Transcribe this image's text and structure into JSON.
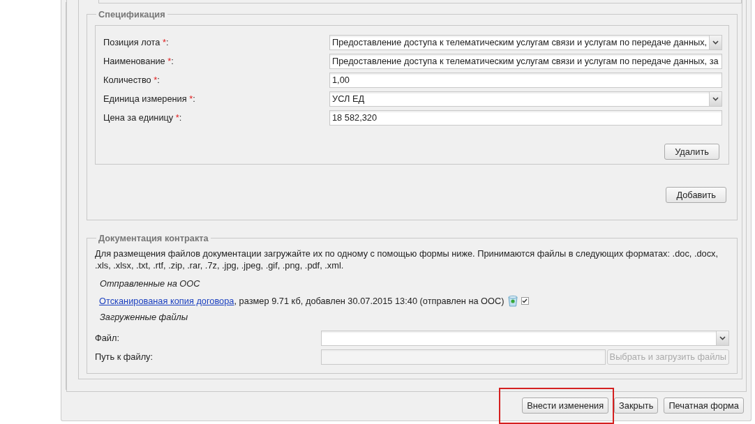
{
  "specification": {
    "title": "Спецификация",
    "fields": [
      {
        "kind": "select",
        "label": "Позиция лота",
        "required_mark": "*",
        "suffix": ":",
        "value": "Предоставление доступа к телематическим услугам связи и услугам по передаче данных,"
      },
      {
        "kind": "input",
        "label": "Наименование",
        "required_mark": "*",
        "suffix": ":",
        "value": "Предоставление доступа к телематическим услугам связи и услугам по передаче данных, за"
      },
      {
        "kind": "input",
        "label": "Количество",
        "required_mark": "*",
        "suffix": ":",
        "value": "1,00"
      },
      {
        "kind": "select",
        "label": "Единица измерения",
        "required_mark": "*",
        "suffix": ":",
        "value": "УСЛ ЕД"
      },
      {
        "kind": "input",
        "label": "Цена за единицу",
        "required_mark": "*",
        "suffix": ":",
        "value": "18 582,320"
      }
    ],
    "delete_button": "Удалить",
    "add_button": "Добавить"
  },
  "documentation": {
    "title": "Документация контракта",
    "hint": "Для размещения файлов документации загружайте их по одному с помощью формы ниже. Принимаются файлы в следующих форматах: .doc, .docx, .xls, .xlsx, .txt, .rtf, .zip, .rar, .7z, .jpg, .jpeg, .gif, .png, .pdf, .xml.",
    "sent_heading": "Отправленные на ООС",
    "sent_files": [
      {
        "link": "Отсканированая копия договора",
        "details": ", размер 9.71 кб, добавлен 30.07.2015 13:40 (отправлен на ООС)",
        "checked": true
      }
    ],
    "uploaded_heading": "Загруженные файлы",
    "fields": [
      {
        "kind": "select",
        "label": "Файл:"
      },
      {
        "kind": "input",
        "label": "Путь к файлу:",
        "disabled": true,
        "button": "Выбрать и загрузить файлы"
      }
    ]
  },
  "footer_buttons": [
    {
      "label": "Внести изменения",
      "highlighted": true
    },
    {
      "label": "Закрыть",
      "highlighted": false
    },
    {
      "label": "Печатная форма",
      "highlighted": false
    }
  ]
}
